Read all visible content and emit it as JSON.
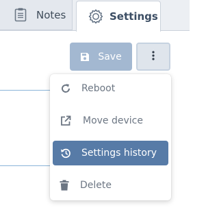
{
  "tabs": [
    {
      "label": "Notes",
      "icon": "clipboard-icon",
      "active": false
    },
    {
      "label": "Settings",
      "icon": "gear-icon",
      "active": true
    }
  ],
  "toolbar": {
    "save_label": "Save",
    "save_icon": "floppy-disk-icon",
    "more_icon": "vertical-ellipsis-icon"
  },
  "menu": {
    "items": [
      {
        "label": "Reboot",
        "icon": "refresh-icon",
        "active": false
      },
      {
        "label": "Move device",
        "icon": "external-link-icon",
        "active": false
      },
      {
        "label": "Settings history",
        "icon": "history-icon",
        "active": true
      },
      {
        "label": "Delete",
        "icon": "trash-icon",
        "active": false
      }
    ]
  },
  "colors": {
    "accent": "#577ba7",
    "save_disabled": "#a3b8d1",
    "tab_bar": "#eceff3"
  }
}
